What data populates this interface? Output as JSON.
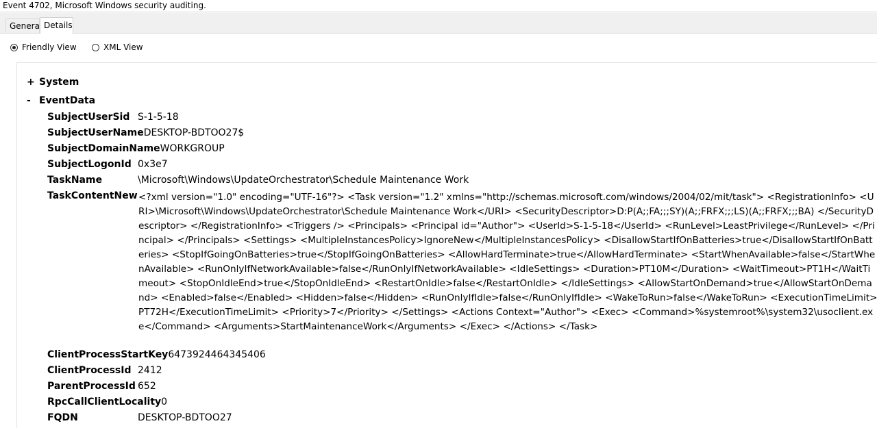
{
  "window": {
    "title": "Event 4702, Microsoft Windows security auditing."
  },
  "tabs": [
    {
      "label": "General"
    },
    {
      "label": "Details"
    }
  ],
  "view_options": {
    "friendly_label": "Friendly View",
    "xml_label": "XML View"
  },
  "tree": {
    "system": {
      "toggle": "+",
      "label": "System"
    },
    "eventdata": {
      "toggle": "-",
      "label": "EventData"
    }
  },
  "fields": {
    "SubjectUserSid": {
      "name": "SubjectUserSid",
      "value": "S-1-5-18"
    },
    "SubjectUserName": {
      "name": "SubjectUserName",
      "value": "DESKTOP-BDTOO27$"
    },
    "SubjectDomainName": {
      "name": "SubjectDomainName",
      "value": "WORKGROUP"
    },
    "SubjectLogonId": {
      "name": "SubjectLogonId",
      "value": "0x3e7"
    },
    "TaskName": {
      "name": "TaskName",
      "value": "\\Microsoft\\Windows\\UpdateOrchestrator\\Schedule Maintenance Work"
    },
    "TaskContentNew": {
      "name": "TaskContentNew",
      "value": "<?xml version=\"1.0\" encoding=\"UTF-16\"?> <Task version=\"1.2\" xmlns=\"http://schemas.microsoft.com/windows/2004/02/mit/task\"> <RegistrationInfo> <URI>\\Microsoft\\Windows\\UpdateOrchestrator\\Schedule Maintenance Work</URI> <SecurityDescriptor>D:P(A;;FA;;;SY)(A;;FRFX;;;LS)(A;;FRFX;;;BA) </SecurityDescriptor> </RegistrationInfo> <Triggers /> <Principals> <Principal id=\"Author\"> <UserId>S-1-5-18</UserId> <RunLevel>LeastPrivilege</RunLevel> </Principal> </Principals> <Settings> <MultipleInstancesPolicy>IgnoreNew</MultipleInstancesPolicy> <DisallowStartIfOnBatteries>true</DisallowStartIfOnBatteries> <StopIfGoingOnBatteries>true</StopIfGoingOnBatteries> <AllowHardTerminate>true</AllowHardTerminate> <StartWhenAvailable>false</StartWhenAvailable> <RunOnlyIfNetworkAvailable>false</RunOnlyIfNetworkAvailable> <IdleSettings> <Duration>PT10M</Duration> <WaitTimeout>PT1H</WaitTimeout> <StopOnIdleEnd>true</StopOnIdleEnd> <RestartOnIdle>false</RestartOnIdle> </IdleSettings> <AllowStartOnDemand>true</AllowStartOnDemand> <Enabled>false</Enabled> <Hidden>false</Hidden> <RunOnlyIfIdle>false</RunOnlyIfIdle> <WakeToRun>false</WakeToRun> <ExecutionTimeLimit>PT72H</ExecutionTimeLimit> <Priority>7</Priority> </Settings> <Actions Context=\"Author\"> <Exec> <Command>%systemroot%\\system32\\usoclient.exe</Command> <Arguments>StartMaintenanceWork</Arguments> </Exec> </Actions> </Task>"
    },
    "ClientProcessStartKey": {
      "name": "ClientProcessStartKey",
      "value": "6473924464345406"
    },
    "ClientProcessId": {
      "name": "ClientProcessId",
      "value": "2412"
    },
    "ParentProcessId": {
      "name": "ParentProcessId",
      "value": "652"
    },
    "RpcCallClientLocality": {
      "name": "RpcCallClientLocality",
      "value": "0"
    },
    "FQDN": {
      "name": "FQDN",
      "value": "DESKTOP-BDTOO27"
    }
  }
}
